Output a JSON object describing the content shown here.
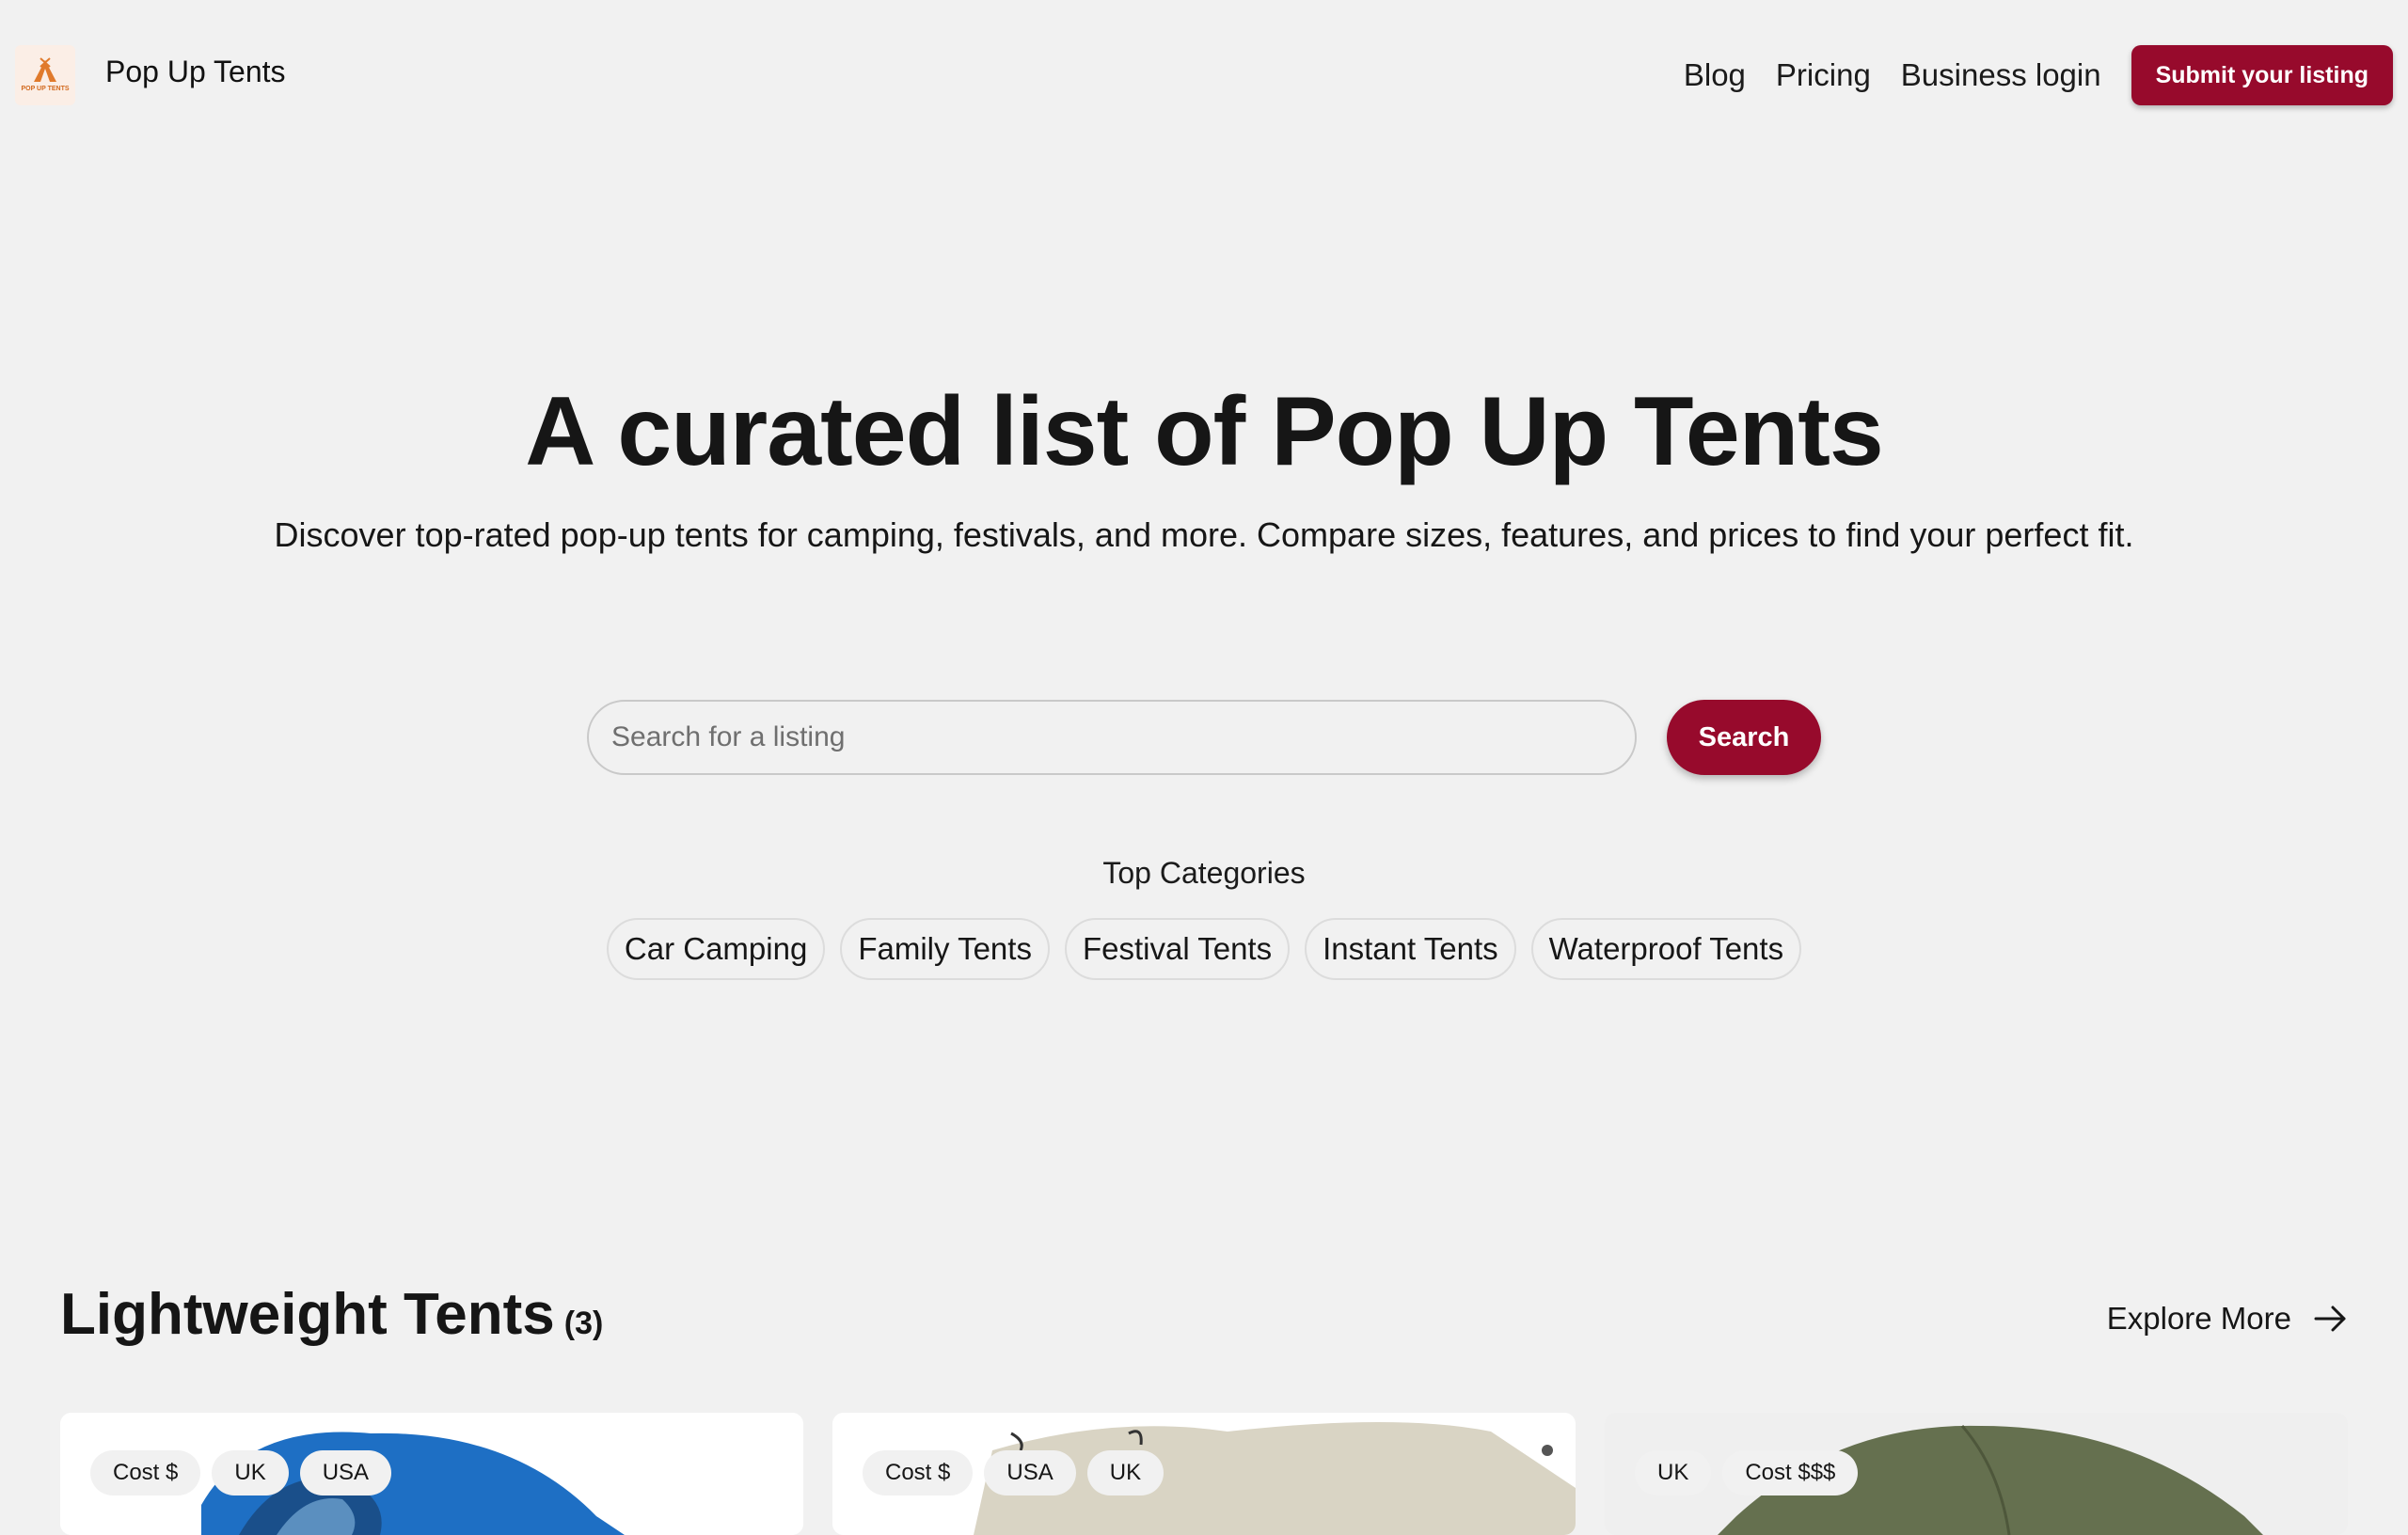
{
  "header": {
    "brand": "Pop Up Tents",
    "logo_text": "POP UP TENTS",
    "nav": [
      "Blog",
      "Pricing",
      "Business login"
    ],
    "submit_label": "Submit your listing"
  },
  "hero": {
    "title": "A curated list of Pop Up Tents",
    "subtitle": "Discover top-rated pop-up tents for camping, festivals, and more. Compare sizes, features, and prices to find your perfect fit."
  },
  "search": {
    "placeholder": "Search for a listing",
    "button_label": "Search"
  },
  "categories": {
    "label": "Top Categories",
    "items": [
      "Car Camping",
      "Family Tents",
      "Festival Tents",
      "Instant Tents",
      "Waterproof Tents"
    ]
  },
  "section": {
    "title": "Lightweight Tents",
    "count": "(3)",
    "explore_label": "Explore More"
  },
  "cards": [
    {
      "tags": [
        "Cost $",
        "UK",
        "USA"
      ],
      "image_color": "#1e6fc4"
    },
    {
      "tags": [
        "Cost $",
        "USA",
        "UK"
      ],
      "image_color": "#d9d4c4"
    },
    {
      "tags": [
        "UK",
        "Cost $$$"
      ],
      "image_color": "#65704f"
    }
  ],
  "colors": {
    "accent": "#970a2c",
    "background": "#f1f1f1"
  }
}
